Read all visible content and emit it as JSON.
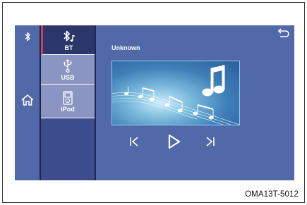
{
  "caption": "OMA13T-5012",
  "sources": [
    {
      "label": "BT",
      "icon": "bluetooth-music-icon",
      "selected": true
    },
    {
      "label": "USB",
      "icon": "usb-icon",
      "selected": false
    },
    {
      "label": "iPod",
      "icon": "ipod-icon",
      "selected": false
    }
  ],
  "player": {
    "track_title": "Unknown",
    "album_art": "music-notes-artwork",
    "controls": [
      "previous-track-icon",
      "play-icon",
      "next-track-icon"
    ],
    "back_icon": "back-arrow-icon"
  },
  "rail": {
    "top_icon": "bluetooth-icon",
    "home_icon": "home-icon"
  },
  "colors": {
    "screen": "#5169a8",
    "source_panel": "#3c4c8c",
    "source_selected": "#2b376a",
    "source_inactive": "#8a95c2",
    "selection_marker": "#c8405a",
    "album_border": "#8fd0ee"
  }
}
